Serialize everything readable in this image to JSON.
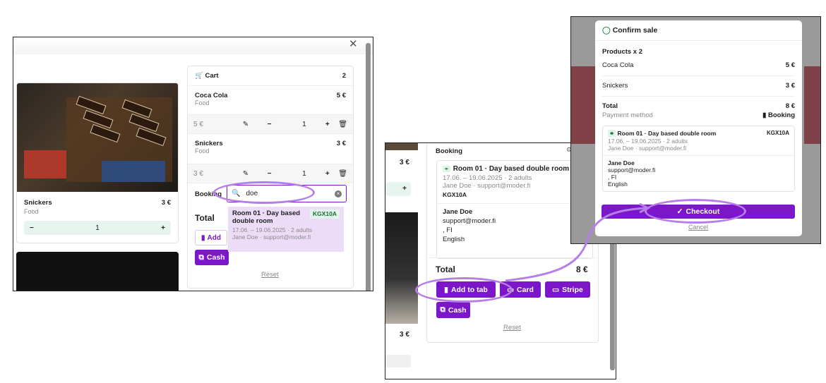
{
  "panel1": {
    "cart": {
      "title": "Cart",
      "count": "2"
    },
    "items": [
      {
        "name": "Coca Cola",
        "category": "Food",
        "price": "5 €",
        "unit_price": "5 €",
        "qty": "1"
      },
      {
        "name": "Snickers",
        "category": "Food",
        "price": "3 €",
        "unit_price": "3 €",
        "qty": "1"
      }
    ],
    "product_card": {
      "name": "Snickers",
      "category": "Food",
      "price": "3 €",
      "qty": "1"
    },
    "booking_label": "Booking",
    "search": {
      "value": "doe"
    },
    "result": {
      "title": "Room 01 · Day based double room",
      "code": "KGX10A",
      "dates": "17.06. – 19.06.2025 · 2 adults",
      "guest": "Jane Doe · support@moder.fi"
    },
    "total_label": "Total",
    "add_label": "Add",
    "cash_label": "Cash",
    "reset_label": "Reset"
  },
  "panel2": {
    "product_price_1": "3 €",
    "product_price_2": "3 €",
    "booking_label": "Booking",
    "booking_card": {
      "title": "Room 01 · Day based double room",
      "dates": "17.06. – 19.06.2025 · 2 adults",
      "guest": "Jane Doe · support@moder.fi",
      "code": "KGX10A"
    },
    "guest": {
      "name": "Jane Doe",
      "email": "support@moder.fi",
      "country": ", FI",
      "language": "English"
    },
    "total_label": "Total",
    "total_value": "8 €",
    "buttons": {
      "add_to_tab": "Add to tab",
      "card": "Card",
      "stripe": "Stripe",
      "cash": "Cash"
    },
    "reset_label": "Reset"
  },
  "panel3": {
    "title": "Confirm sale",
    "products_heading": "Products x 2",
    "items": [
      {
        "name": "Coca Cola",
        "price": "5 €"
      },
      {
        "name": "Snickers",
        "price": "3 €"
      }
    ],
    "total_label": "Total",
    "total_value": "8 €",
    "payment_label": "Payment method",
    "payment_value": "Booking",
    "booking": {
      "title": "Room 01 · Day based double room",
      "code": "KGX10A",
      "dates": "17.06. – 19.06.2025 · 2 adults",
      "guest": "Jane Doe · support@moder.fi"
    },
    "guest": {
      "name": "Jane Doe",
      "email": "support@moder.fi",
      "country": ", FI",
      "language": "English"
    },
    "checkout_label": "Checkout",
    "cancel_label": "Cancel"
  },
  "colors": {
    "accent": "#7b16c9",
    "highlight": "#b57ee8",
    "green_bg": "#e6f6ee"
  }
}
